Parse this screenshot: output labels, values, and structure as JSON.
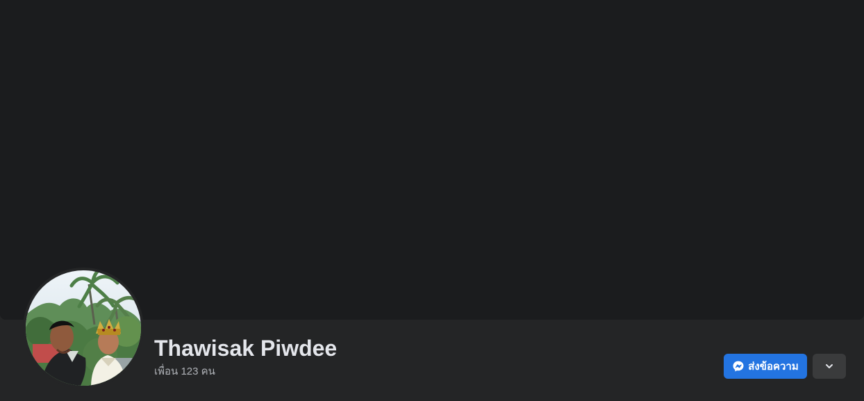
{
  "profile": {
    "name": "Thawisak Piwdee",
    "friends_text": "เพื่อน 123 คน"
  },
  "actions": {
    "message_label": "ส่งข้อความ",
    "message_icon": "messenger-icon",
    "more_icon": "chevron-down-icon"
  },
  "theme": {
    "background": "#242526",
    "cover": "#1b1c1e",
    "primary_button": "#2374e1",
    "secondary_button": "#3a3b3c",
    "text_primary": "#e4e6eb",
    "text_secondary": "#b0b3b8"
  }
}
